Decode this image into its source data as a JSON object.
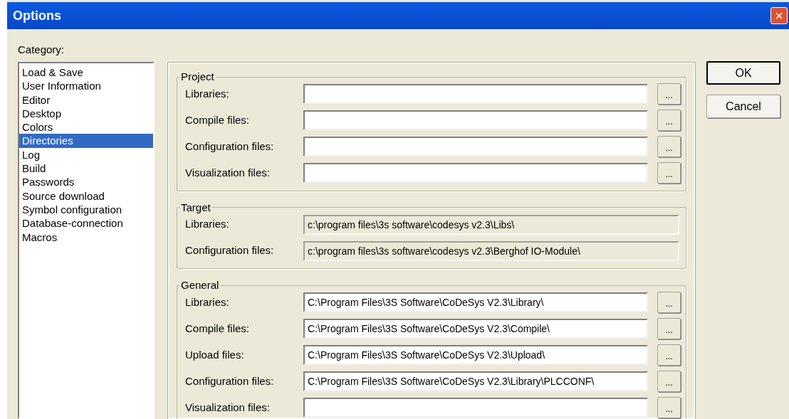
{
  "window": {
    "title": "Options",
    "close": "×"
  },
  "category": {
    "label": "Category:",
    "items": [
      {
        "label": "Load & Save",
        "selected": false
      },
      {
        "label": "User Information",
        "selected": false
      },
      {
        "label": "Editor",
        "selected": false
      },
      {
        "label": "Desktop",
        "selected": false
      },
      {
        "label": "Colors",
        "selected": false
      },
      {
        "label": "Directories",
        "selected": true
      },
      {
        "label": "Log",
        "selected": false
      },
      {
        "label": "Build",
        "selected": false
      },
      {
        "label": "Passwords",
        "selected": false
      },
      {
        "label": "Source download",
        "selected": false
      },
      {
        "label": "Symbol configuration",
        "selected": false
      },
      {
        "label": "Database-connection",
        "selected": false
      },
      {
        "label": "Macros",
        "selected": false
      }
    ]
  },
  "groups": [
    {
      "title": "Project",
      "fields": [
        {
          "label": "Libraries:",
          "kind": "editable",
          "browse": "..."
        },
        {
          "label": "Compile files:",
          "kind": "editable",
          "browse": "..."
        },
        {
          "label": "Configuration files:",
          "kind": "editable",
          "browse": "..."
        },
        {
          "label": "Visualization files:",
          "kind": "editable",
          "browse": "..."
        }
      ]
    },
    {
      "title": "Target",
      "fields": [
        {
          "label": "Libraries:",
          "kind": "readonly",
          "value": "c:\\program files\\3s software\\codesys v2.3\\Libs\\"
        },
        {
          "label": "Configuration files:",
          "kind": "readonly",
          "value": "c:\\program files\\3s software\\codesys v2.3\\Berghof IO-Module\\"
        }
      ]
    },
    {
      "title": "General",
      "fields": [
        {
          "label": "Libraries:",
          "kind": "editable",
          "value": "C:\\Program Files\\3S Software\\CoDeSys V2.3\\Library\\",
          "browse": "..."
        },
        {
          "label": "Compile files:",
          "kind": "editable",
          "value": "C:\\Program Files\\3S Software\\CoDeSys V2.3\\Compile\\",
          "browse": "..."
        },
        {
          "label": "Upload files:",
          "kind": "editable",
          "value": "C:\\Program Files\\3S Software\\CoDeSys V2.3\\Upload\\",
          "browse": "..."
        },
        {
          "label": "Configuration files:",
          "kind": "editable",
          "value": "C:\\Program Files\\3S Software\\CoDeSys V2.3\\Library\\PLCCONF\\",
          "browse": "..."
        },
        {
          "label": "Visualization files:",
          "kind": "editable",
          "browse": "..."
        }
      ]
    }
  ],
  "buttons": [
    {
      "label": "OK",
      "default": true
    },
    {
      "label": "Cancel",
      "default": false
    }
  ]
}
